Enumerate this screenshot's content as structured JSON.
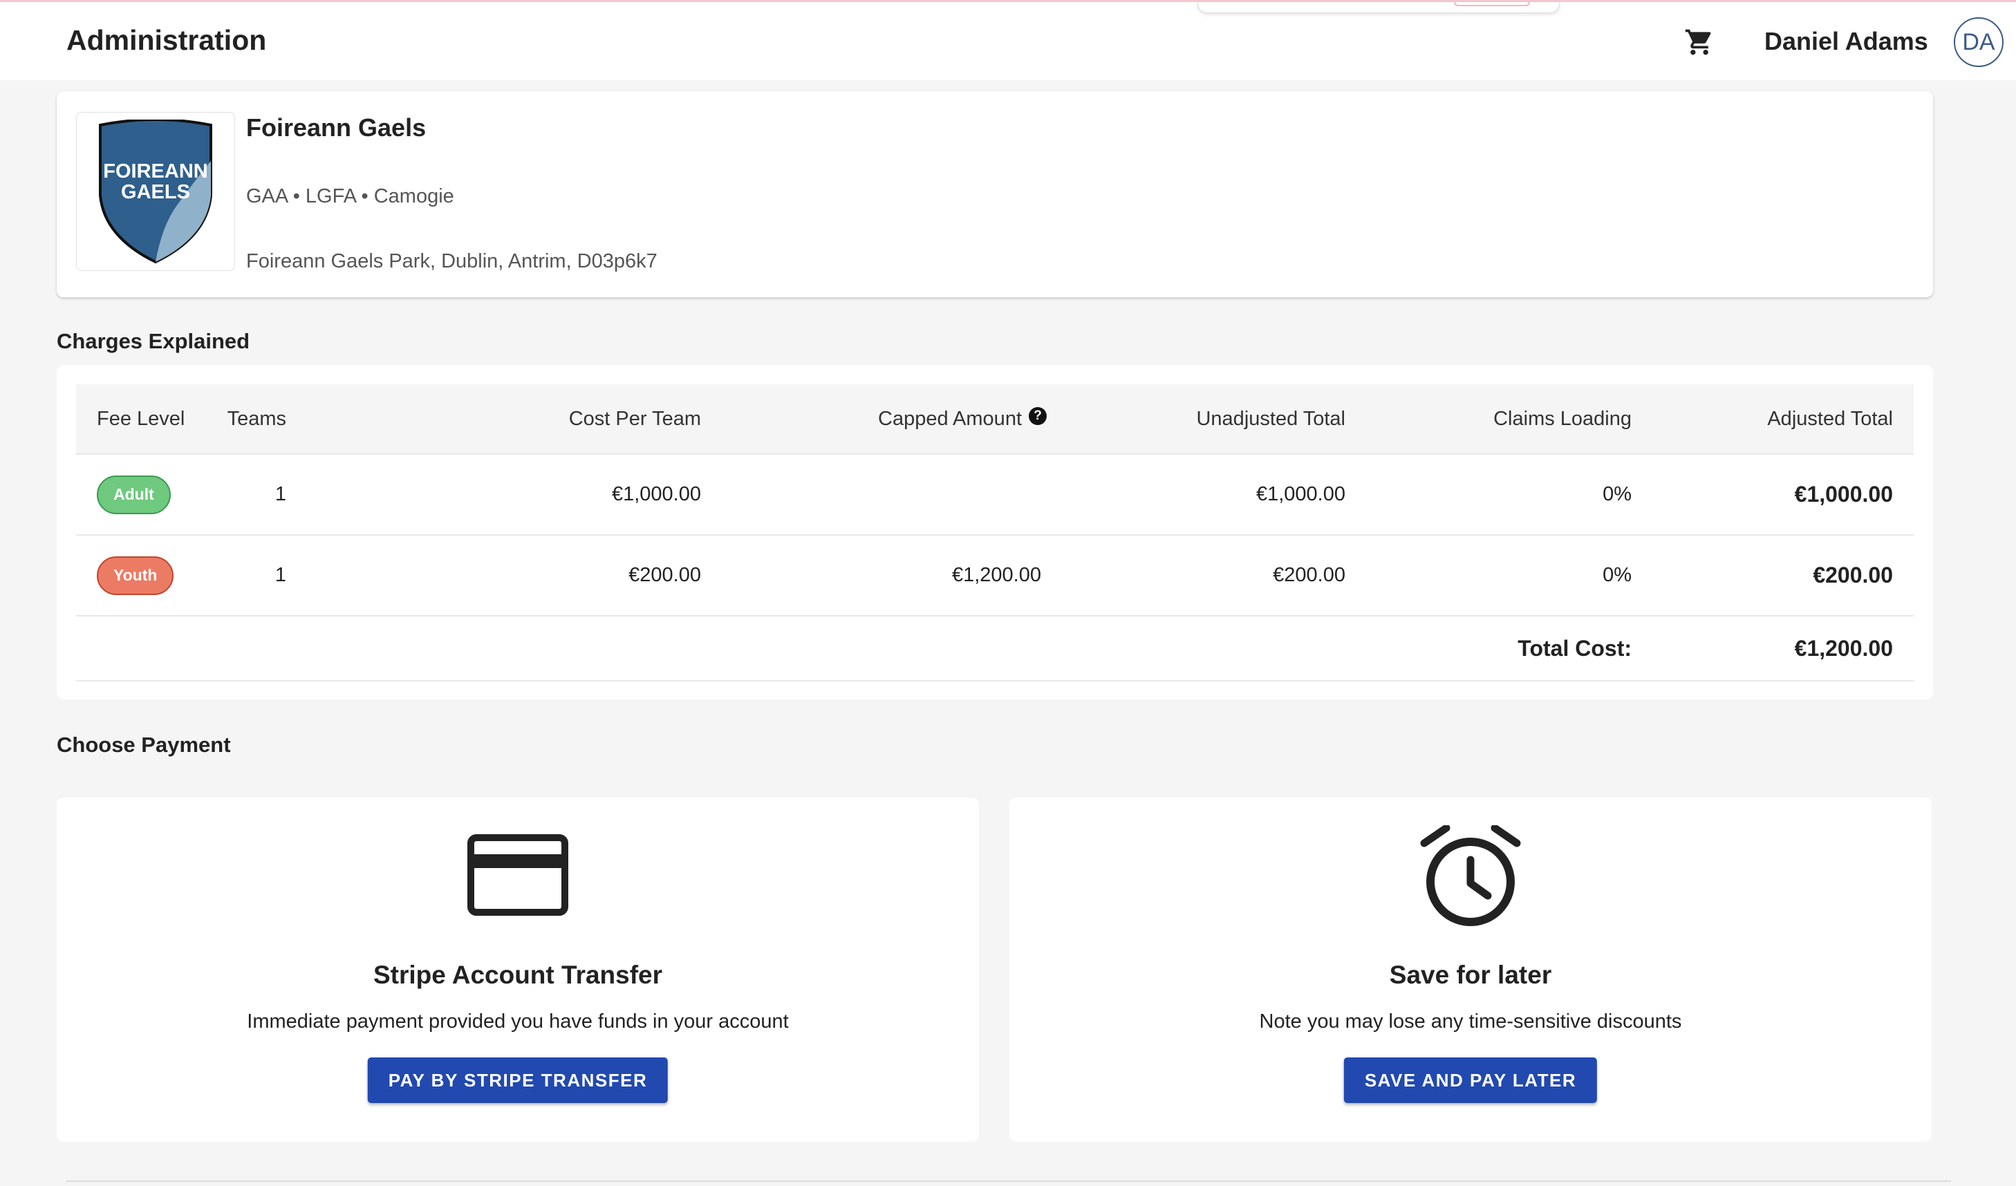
{
  "header": {
    "title": "Administration",
    "cart_icon": "shopping-cart-icon",
    "user_name": "Daniel Adams",
    "avatar_initials": "DA"
  },
  "club": {
    "name": "Foireann Gaels",
    "crest_text_line1": "FOIREANN",
    "crest_text_line2": "GAELS",
    "codes": "GAA • LGFA • Camogie",
    "address": "Foireann Gaels Park, Dublin, Antrim, D03p6k7"
  },
  "charges": {
    "section_title": "Charges Explained",
    "columns": {
      "fee_level": "Fee Level",
      "teams": "Teams",
      "cost_per_team": "Cost Per Team",
      "capped_amount": "Capped Amount",
      "unadjusted_total": "Unadjusted Total",
      "claims_loading": "Claims Loading",
      "adjusted_total": "Adjusted Total"
    },
    "help_icon": "question-circle-icon",
    "rows": [
      {
        "fee_level": "Adult",
        "teams": "1",
        "cost_per_team": "€1,000.00",
        "capped_amount": "",
        "unadjusted_total": "€1,000.00",
        "claims_loading": "0%",
        "adjusted_total": "€1,000.00"
      },
      {
        "fee_level": "Youth",
        "teams": "1",
        "cost_per_team": "€200.00",
        "capped_amount": "€1,200.00",
        "unadjusted_total": "€200.00",
        "claims_loading": "0%",
        "adjusted_total": "€200.00"
      }
    ],
    "total_label": "Total Cost:",
    "total_value": "€1,200.00"
  },
  "payment": {
    "section_title": "Choose Payment",
    "options": [
      {
        "icon": "credit-card-icon",
        "title": "Stripe Account Transfer",
        "description": "Immediate payment provided you have funds in your account",
        "button_label": "PAY BY STRIPE TRANSFER"
      },
      {
        "icon": "alarm-clock-icon",
        "title": "Save for later",
        "description": "Note you may lose any time-sensitive discounts",
        "button_label": "SAVE AND PAY LATER"
      }
    ]
  },
  "colors": {
    "primary_button": "#2149b0",
    "adult_badge": "#6fc97f",
    "youth_badge": "#ec7b63",
    "crest_blue": "#2f5f8c"
  }
}
